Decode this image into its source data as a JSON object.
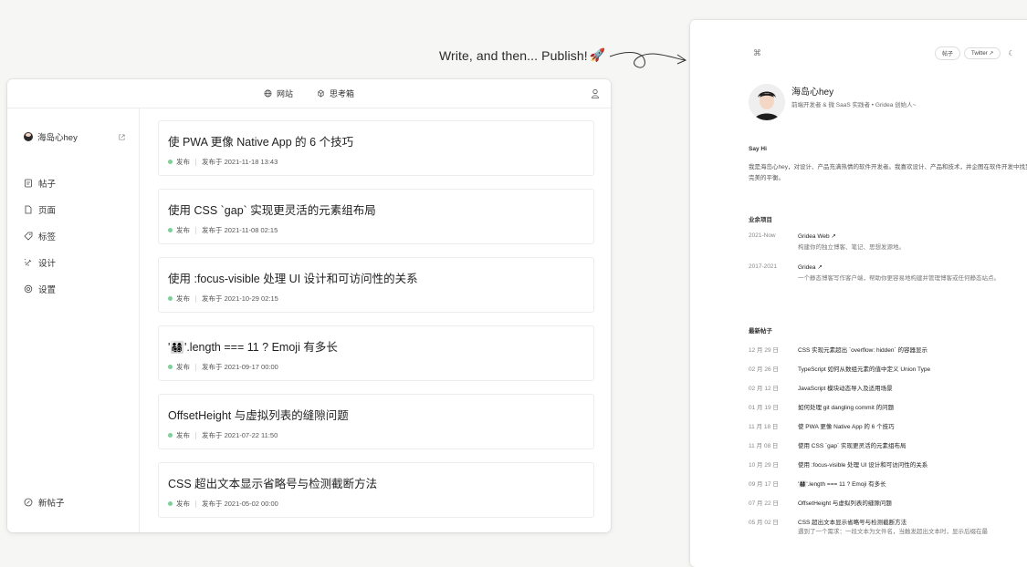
{
  "caption": {
    "text": "Write, and then... Publish!",
    "emoji": "🚀"
  },
  "admin": {
    "topnav": [
      {
        "label": "网站",
        "icon": "globe-icon"
      },
      {
        "label": "思考箱",
        "icon": "thinking-box-icon"
      }
    ],
    "sidebar": {
      "profile_name": "海岛心hey",
      "items": [
        {
          "label": "帖子",
          "icon": "posts-icon"
        },
        {
          "label": "页面",
          "icon": "page-icon"
        },
        {
          "label": "标签",
          "icon": "tag-icon"
        },
        {
          "label": "设计",
          "icon": "design-icon"
        },
        {
          "label": "设置",
          "icon": "settings-icon"
        }
      ],
      "new_post": "新帖子"
    },
    "posts": [
      {
        "title": "使 PWA 更像 Native App 的 6 个技巧",
        "status": "发布",
        "date": "发布于 2021-11-18 13:43"
      },
      {
        "title": "使用 CSS `gap` 实现更灵活的元素组布局",
        "status": "发布",
        "date": "发布于 2021-11-08 02:15"
      },
      {
        "title": "使用 :focus-visible 处理 UI 设计和可访问性的关系",
        "status": "发布",
        "date": "发布于 2021-10-29 02:15"
      },
      {
        "title": "'👨‍👩‍👧‍👦'.length === 11 ? Emoji 有多长",
        "status": "发布",
        "date": "发布于 2021-09-17 00:00"
      },
      {
        "title": "OffsetHeight 与虚拟列表的缝隙问题",
        "status": "发布",
        "date": "发布于 2021-07-22 11:50"
      },
      {
        "title": "CSS 超出文本显示省略号与检测截断方法",
        "status": "发布",
        "date": "发布于 2021-05-02 00:00"
      }
    ],
    "accent_dot": "#7fcf9a"
  },
  "blog": {
    "logo": "⌘",
    "nav": {
      "posts": "帖子",
      "twitter": "Twitter ↗",
      "theme_icon": "☾"
    },
    "name": "海岛心hey",
    "bio": "前端开发者 & 微 SaaS 实践者 • Gridea 创始人~",
    "say_hi_heading": "Say Hi",
    "say_hi_text": "我是海岛心hey，对设计、产品充满热情的软件开发者。我喜欢设计、产品和技术，并企图在软件开发中找到完美的平衡。",
    "projects_heading": "业余项目",
    "projects": [
      {
        "years": "2021-Now",
        "name": "Gridea Web ↗",
        "desc": "构建你的独立博客、笔记、思想发源地。"
      },
      {
        "years": "2017-2021",
        "name": "Gridea ↗",
        "desc": "一个静态博客写作客户端，帮助你更容易地构建并管理博客或任何静态站点。"
      }
    ],
    "latest_heading": "最新帖子",
    "latest": [
      {
        "date": "12 月 29 日",
        "title": "CSS 实现元素超出 `overflow: hidden` 的容器显示"
      },
      {
        "date": "02 月 26 日",
        "title": "TypeScript 如何从数组元素的值中定义 Union Type"
      },
      {
        "date": "02 月 12 日",
        "title": "JavaScript 模块动态导入及适用场景"
      },
      {
        "date": "01 月 19 日",
        "title": "如何处理 git dangling commit 的问题"
      },
      {
        "date": "11 月 18 日",
        "title": "使 PWA 更像 Native App 的 6 个技巧"
      },
      {
        "date": "11 月 08 日",
        "title": "使用 CSS `gap` 实现更灵活的元素组布局"
      },
      {
        "date": "10 月 29 日",
        "title": "使用 :focus-visible 处理 UI 设计和可访问性的关系"
      },
      {
        "date": "09 月 17 日",
        "title": "'👨‍👩‍👧‍👦'.length === 11 ? Emoji 有多长"
      },
      {
        "date": "07 月 22 日",
        "title": "OffsetHeight 与虚拟列表的缝隙问题"
      },
      {
        "date": "05 月 02 日",
        "title": "CSS 超出文本显示省略号与检测截断方法",
        "excerpt": "遇到了一个需求：一段文本为文件名，当触发超出文本时，显示后缀在最"
      }
    ]
  }
}
